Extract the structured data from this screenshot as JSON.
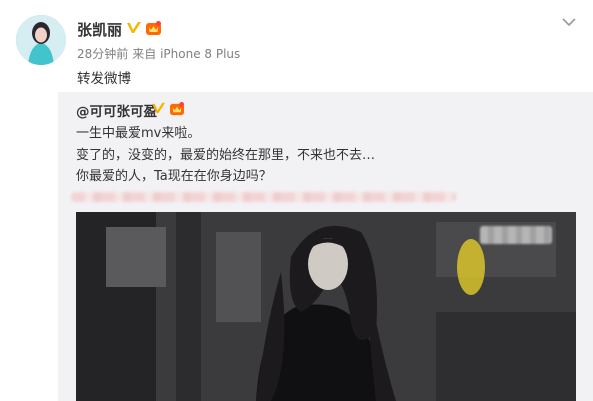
{
  "post": {
    "username": "张凯丽",
    "time": "28分钟前",
    "source": "来自 iPhone 8 Plus",
    "text": "转发微博",
    "icons": {
      "avatar": "user-avatar",
      "verified": "verified-v-icon",
      "vip": "vip-crown-icon",
      "menu": "chevron-down-icon"
    }
  },
  "quoted": {
    "author": "@可可张可盈",
    "lines": [
      "一生中最爱mv来啦。",
      "变了的，没变的，最爱的始终在那里，不来也不去…",
      "你最爱的人，Ta现在在你身边吗？"
    ]
  },
  "colors": {
    "verified": "#f7b500",
    "vip": "#ff6a00",
    "quoted_bg": "#f2f2f5",
    "meta": "#808080"
  }
}
